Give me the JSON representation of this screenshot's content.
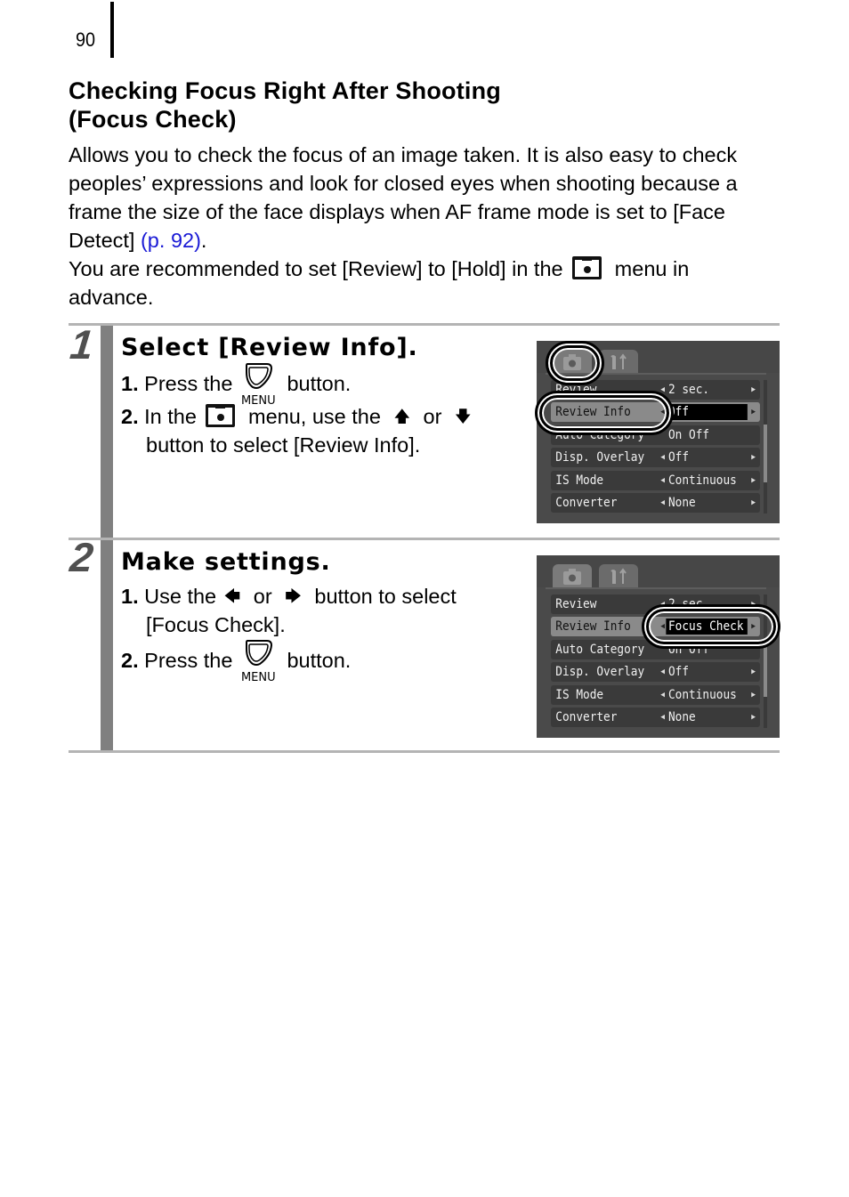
{
  "page": {
    "number": "90",
    "title_line1": "Checking Focus Right After Shooting",
    "title_line2": "(Focus Check)",
    "intro": {
      "p1_text": "Allows you to check the focus of an image taken. It is also easy to check peoples’ expressions and look for closed eyes when shooting because a frame the size of the face displays when AF frame mode is set to [Face Detect] ",
      "p1_link": "(p. 92)",
      "p1_end": ".",
      "p2_before": "You are recommended to set [Review] to [Hold] in the ",
      "p2_icon": "camera-menu-icon",
      "p2_after": " menu in",
      "p2_line2": "advance."
    }
  },
  "icons": {
    "menu_button_label": "MENU",
    "up_arrow": "▲",
    "down_arrow": "▼",
    "left_arrow": "◀",
    "right_arrow": "▶"
  },
  "steps": [
    {
      "number": "1",
      "title": "Select [Review Info].",
      "instructions": [
        {
          "num": "1.",
          "before": "Press the ",
          "after": " button."
        },
        {
          "num": "2.",
          "before": "In the ",
          "middle": " menu, use the ",
          "or": " or ",
          "line2": "button to select [Review Info]."
        }
      ],
      "screen": {
        "tabs": [
          "camera-tab",
          "settings-tab"
        ],
        "rows": [
          {
            "label": "Review",
            "value": "2 sec."
          },
          {
            "label": "Review Info",
            "value": "Off",
            "selected": true
          },
          {
            "label": "Auto Category",
            "value": "On Off"
          },
          {
            "label": "Disp. Overlay",
            "value": "Off"
          },
          {
            "label": "IS Mode",
            "value": "Continuous"
          },
          {
            "label": "Converter",
            "value": "None"
          }
        ]
      }
    },
    {
      "number": "2",
      "title": "Make settings.",
      "instructions": [
        {
          "num": "1.",
          "before": "Use the ",
          "or": " or ",
          "after": " button to select",
          "line2": "[Focus Check]."
        },
        {
          "num": "2.",
          "before": "Press the ",
          "after": " button."
        }
      ],
      "screen": {
        "tabs": [
          "camera-tab",
          "settings-tab"
        ],
        "rows": [
          {
            "label": "Review",
            "value": "2 sec."
          },
          {
            "label": "Review Info",
            "value": "Focus Check",
            "selected": true
          },
          {
            "label": "Auto Category",
            "value": "On Off"
          },
          {
            "label": "Disp. Overlay",
            "value": "Off"
          },
          {
            "label": "IS Mode",
            "value": "Continuous"
          },
          {
            "label": "Converter",
            "value": "None"
          }
        ]
      }
    }
  ]
}
